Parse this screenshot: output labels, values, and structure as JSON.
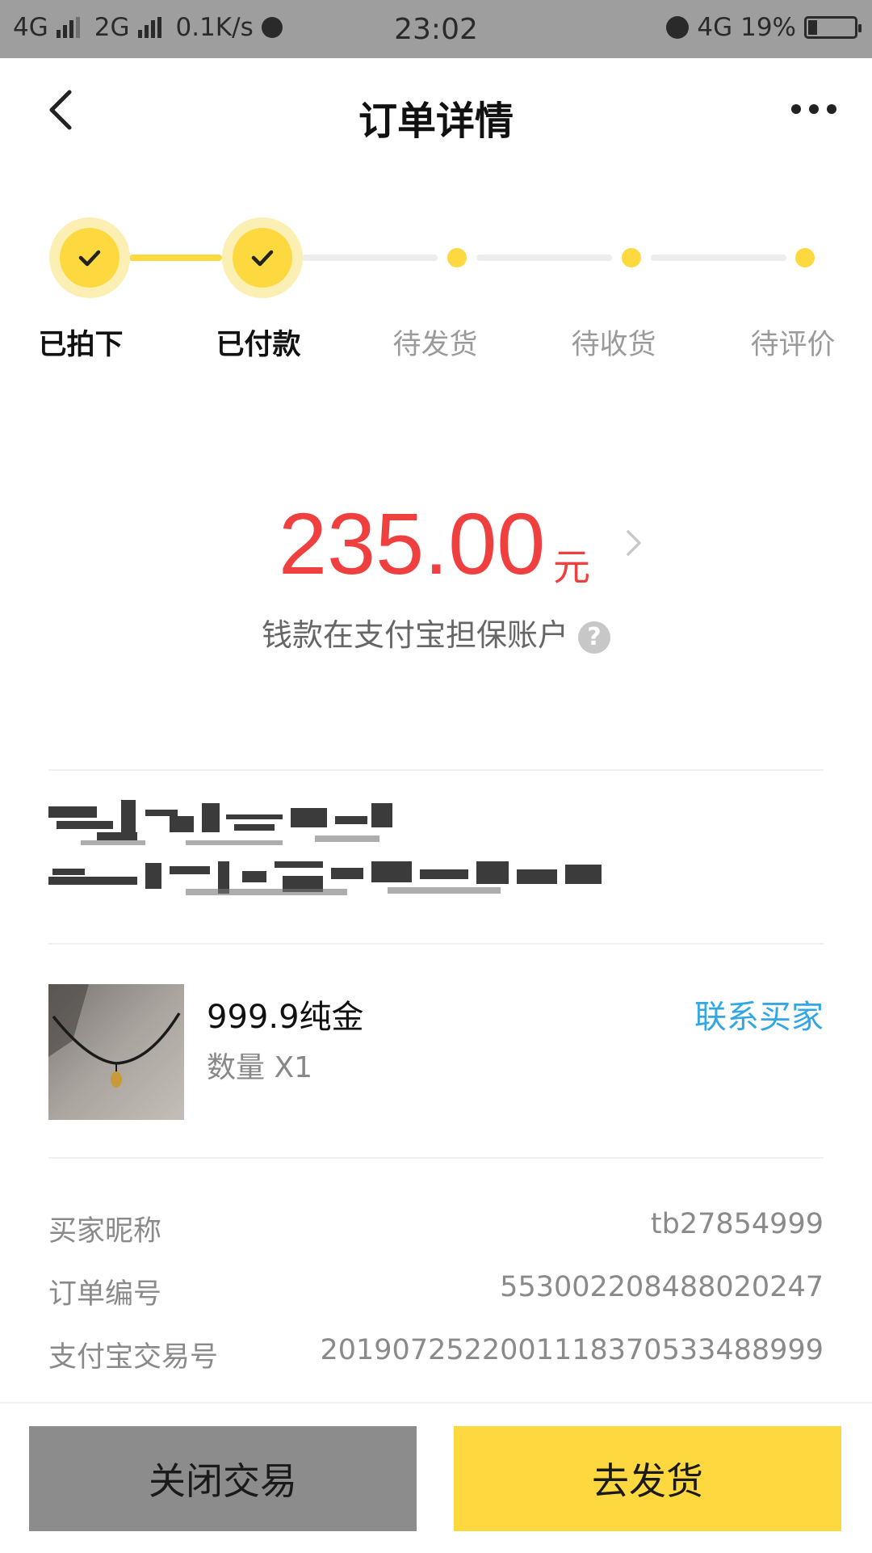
{
  "status_bar": {
    "net1": "4G",
    "net2": "2G",
    "speed": "0.1K/s",
    "time": "23:02",
    "net3": "4G",
    "battery": "19%",
    "battery_level": 0.19,
    "icons": [
      "signal-icon",
      "sync-icon",
      "alarm-icon",
      "battery-charging-icon"
    ]
  },
  "nav": {
    "title": "订单详情",
    "back_icon": "back-chevron-icon",
    "more_icon": "more-dots-icon"
  },
  "steps": [
    {
      "label": "已拍下",
      "state": "done"
    },
    {
      "label": "已付款",
      "state": "done"
    },
    {
      "label": "待发货",
      "state": "pending"
    },
    {
      "label": "待收货",
      "state": "pending"
    },
    {
      "label": "待评价",
      "state": "pending"
    }
  ],
  "amount": {
    "value": "235.00",
    "unit": "元",
    "note": "钱款在支付宝担保账户",
    "help": "?"
  },
  "product": {
    "name": "999.9纯金",
    "quantity": "数量 X1",
    "contact": "联系买家"
  },
  "info": [
    {
      "key": "买家昵称",
      "value": "tb27854999"
    },
    {
      "key": "订单编号",
      "value": "553002208488020247"
    },
    {
      "key": "支付宝交易号",
      "value": "2019072522001118370533488999"
    }
  ],
  "actions": {
    "close": "关闭交易",
    "ship": "去发货"
  },
  "colors": {
    "accent_yellow": "#fdd93f",
    "price_red": "#ef3f3f",
    "link_blue": "#33a7e6",
    "status_bar_gray": "#9e9e9e"
  }
}
